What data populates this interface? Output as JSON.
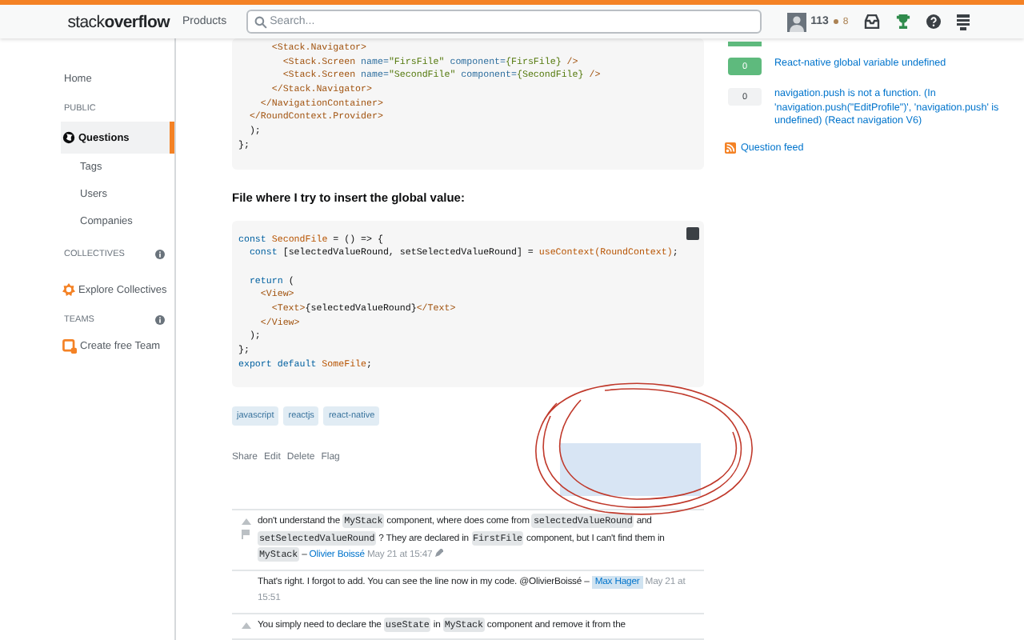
{
  "topbar": {
    "logo": "stack**overflow**",
    "products": "Products",
    "search": {
      "placeholder": "Search..."
    },
    "reputation": "113",
    "bronze": "8"
  },
  "sidebar": {
    "items": [
      {
        "kind": "primary",
        "label": "Home",
        "selected": false
      },
      {
        "kind": "heading",
        "label": "PUBLIC",
        "info": false
      },
      {
        "kind": "globe",
        "label": "Questions",
        "selected": true
      },
      {
        "kind": "sub",
        "label": "Tags",
        "selected": false
      },
      {
        "kind": "sub",
        "label": "Users",
        "selected": false
      },
      {
        "kind": "sub",
        "label": "Companies",
        "selected": false
      },
      {
        "kind": "heading",
        "label": "COLLECTIVES",
        "info": true
      },
      {
        "kind": "collective",
        "label": "Explore Collectives",
        "selected": false
      },
      {
        "kind": "heading",
        "label": "TEAMS",
        "info": true
      },
      {
        "kind": "team",
        "label": "Create free Team",
        "selected": false
      }
    ]
  },
  "post": {
    "code_blocks": [
      {
        "copy_button": false,
        "lines": [
          {
            "segments": [
              {
                "text": "      <Stack.Navigator>",
                "kind": "tag"
              }
            ]
          },
          {
            "segments": [
              {
                "text": "        <Stack.Screen ",
                "kind": "tag"
              },
              {
                "text": "name=",
                "kind": "attr"
              },
              {
                "text": "\"FirsFile\"",
                "kind": "str"
              },
              {
                "text": " component=",
                "kind": "attr"
              },
              {
                "text": "{FirsFile}",
                "kind": "str"
              },
              {
                "text": " />",
                "kind": "tag"
              }
            ]
          },
          {
            "segments": [
              {
                "text": "        <Stack.Screen ",
                "kind": "tag"
              },
              {
                "text": "name=",
                "kind": "attr"
              },
              {
                "text": "\"SecondFile\"",
                "kind": "str"
              },
              {
                "text": " component=",
                "kind": "attr"
              },
              {
                "text": "{SecondFile}",
                "kind": "str"
              },
              {
                "text": " />",
                "kind": "tag"
              }
            ]
          },
          {
            "segments": [
              {
                "text": "      </Stack.Navigator>",
                "kind": "tag"
              }
            ]
          },
          {
            "segments": [
              {
                "text": "    </NavigationContainer>",
                "kind": "tag"
              }
            ]
          },
          {
            "segments": [
              {
                "text": "  </RoundContext.Provider>",
                "kind": "tag"
              }
            ]
          },
          {
            "segments": [
              {
                "text": "  );",
                "kind": "plain"
              }
            ]
          },
          {
            "segments": [
              {
                "text": "};",
                "kind": "plain"
              }
            ]
          }
        ]
      },
      {
        "heading": "File where I try to insert the global value:",
        "copy_button": true,
        "lines": [
          {
            "segments": [
              {
                "text": "const",
                "kind": "kw"
              },
              {
                "text": " SecondFile",
                "kind": "type"
              },
              {
                "text": " = () => {",
                "kind": "plain"
              }
            ]
          },
          {
            "segments": [
              {
                "text": "  const",
                "kind": "kw"
              },
              {
                "text": " [selectedValueRound, setSelectedValueRound] = ",
                "kind": "plain"
              },
              {
                "text": "useContext(RoundContext)",
                "kind": "type"
              },
              {
                "text": ";",
                "kind": "plain"
              }
            ]
          },
          {
            "gap_before": true,
            "segments": [
              {
                "text": "  return",
                "kind": "kw"
              },
              {
                "text": " (",
                "kind": "plain"
              }
            ]
          },
          {
            "segments": [
              {
                "text": "    <View>",
                "kind": "tag"
              }
            ]
          },
          {
            "segments": [
              {
                "text": "      <Text>",
                "kind": "tag"
              },
              {
                "text": "{selectedValueRound}",
                "kind": "plain"
              },
              {
                "text": "</Text>",
                "kind": "tag"
              }
            ]
          },
          {
            "segments": [
              {
                "text": "    </View>",
                "kind": "tag"
              }
            ]
          },
          {
            "segments": [
              {
                "text": "  );",
                "kind": "plain"
              }
            ]
          },
          {
            "segments": [
              {
                "text": "};",
                "kind": "plain"
              }
            ]
          },
          {
            "segments": [
              {
                "text": "export default",
                "kind": "kw"
              },
              {
                "text": " SomeFile",
                "kind": "type"
              },
              {
                "text": ";",
                "kind": "plain"
              }
            ]
          }
        ]
      }
    ],
    "tags": [
      "javascript",
      "reactjs",
      "react-native"
    ],
    "actions": [
      "Share",
      "Edit",
      "Delete",
      "Flag"
    ]
  },
  "comments": [
    {
      "votable": true,
      "flaggable": true,
      "segments": [
        {
          "text": "don't understand the ",
          "kind": "text"
        },
        {
          "text": "MyStack",
          "kind": "code"
        },
        {
          "text": " component, where does come from ",
          "kind": "text"
        },
        {
          "text": "selectedValueRound",
          "kind": "code"
        },
        {
          "text": " and ",
          "kind": "text"
        },
        {
          "text": "setSelectedValueRound",
          "kind": "code"
        },
        {
          "text": " ? They are declared in ",
          "kind": "text"
        },
        {
          "text": "FirstFile",
          "kind": "code"
        },
        {
          "text": " component, but I can't find them in ",
          "kind": "text"
        },
        {
          "text": "MyStack",
          "kind": "code"
        },
        {
          "text": " – ",
          "kind": "text"
        }
      ],
      "user": "Olivier Boissé",
      "op": false,
      "date": "May 21 at 15:47",
      "edited": true
    },
    {
      "votable": false,
      "flaggable": false,
      "segments": [
        {
          "text": "That's right. I forgot to add. You can see the line now in my code. @OlivierBoissé – ",
          "kind": "text"
        }
      ],
      "user": "Max Hager",
      "op": true,
      "date": "May 21 at 15:51",
      "edited": false
    },
    {
      "votable": true,
      "flaggable": false,
      "segments": [
        {
          "text": "You simply need to declare the ",
          "kind": "text"
        },
        {
          "text": "useState",
          "kind": "code"
        },
        {
          "text": " in ",
          "kind": "text"
        },
        {
          "text": "MyStack",
          "kind": "code"
        },
        {
          "text": " component and remove it from the",
          "kind": "text"
        }
      ]
    }
  ],
  "related": [
    {
      "count": "0",
      "answered": true,
      "title": "React-native global variable undefined"
    },
    {
      "count": "0",
      "answered": false,
      "title": "navigation.push is not a function. (In 'navigation.push(\"EditProfile\")', 'navigation.push' is undefined) (React navigation V6)"
    }
  ],
  "question_feed": "Question feed"
}
